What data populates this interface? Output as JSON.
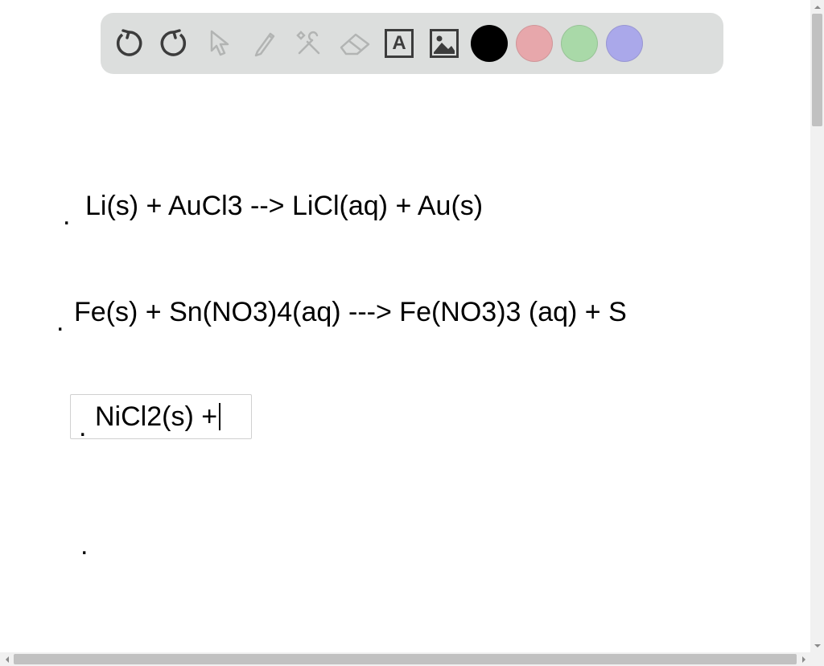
{
  "toolbar": {
    "tools": [
      {
        "name": "undo-icon"
      },
      {
        "name": "redo-icon"
      },
      {
        "name": "pointer-icon"
      },
      {
        "name": "pencil-icon"
      },
      {
        "name": "tools-icon"
      },
      {
        "name": "eraser-icon"
      },
      {
        "name": "text-icon",
        "label": "A"
      },
      {
        "name": "image-icon"
      }
    ],
    "colors": [
      {
        "name": "color-black",
        "hex": "#000000"
      },
      {
        "name": "color-pink",
        "hex": "#e7a7ab"
      },
      {
        "name": "color-green",
        "hex": "#a9d9a8"
      },
      {
        "name": "color-purple",
        "hex": "#aaa8ea"
      }
    ]
  },
  "content": {
    "line1_bullet": ".",
    "line1_text": "Li(s) + AuCl3 --> LiCl(aq) + Au(s)",
    "line2_bullet": ".",
    "line2_text": "Fe(s) + Sn(NO3)4(aq) ---> Fe(NO3)3 (aq) + S",
    "line3_bullet": ".",
    "line3_text": "NiCl2(s) +",
    "line4_bullet": "."
  }
}
